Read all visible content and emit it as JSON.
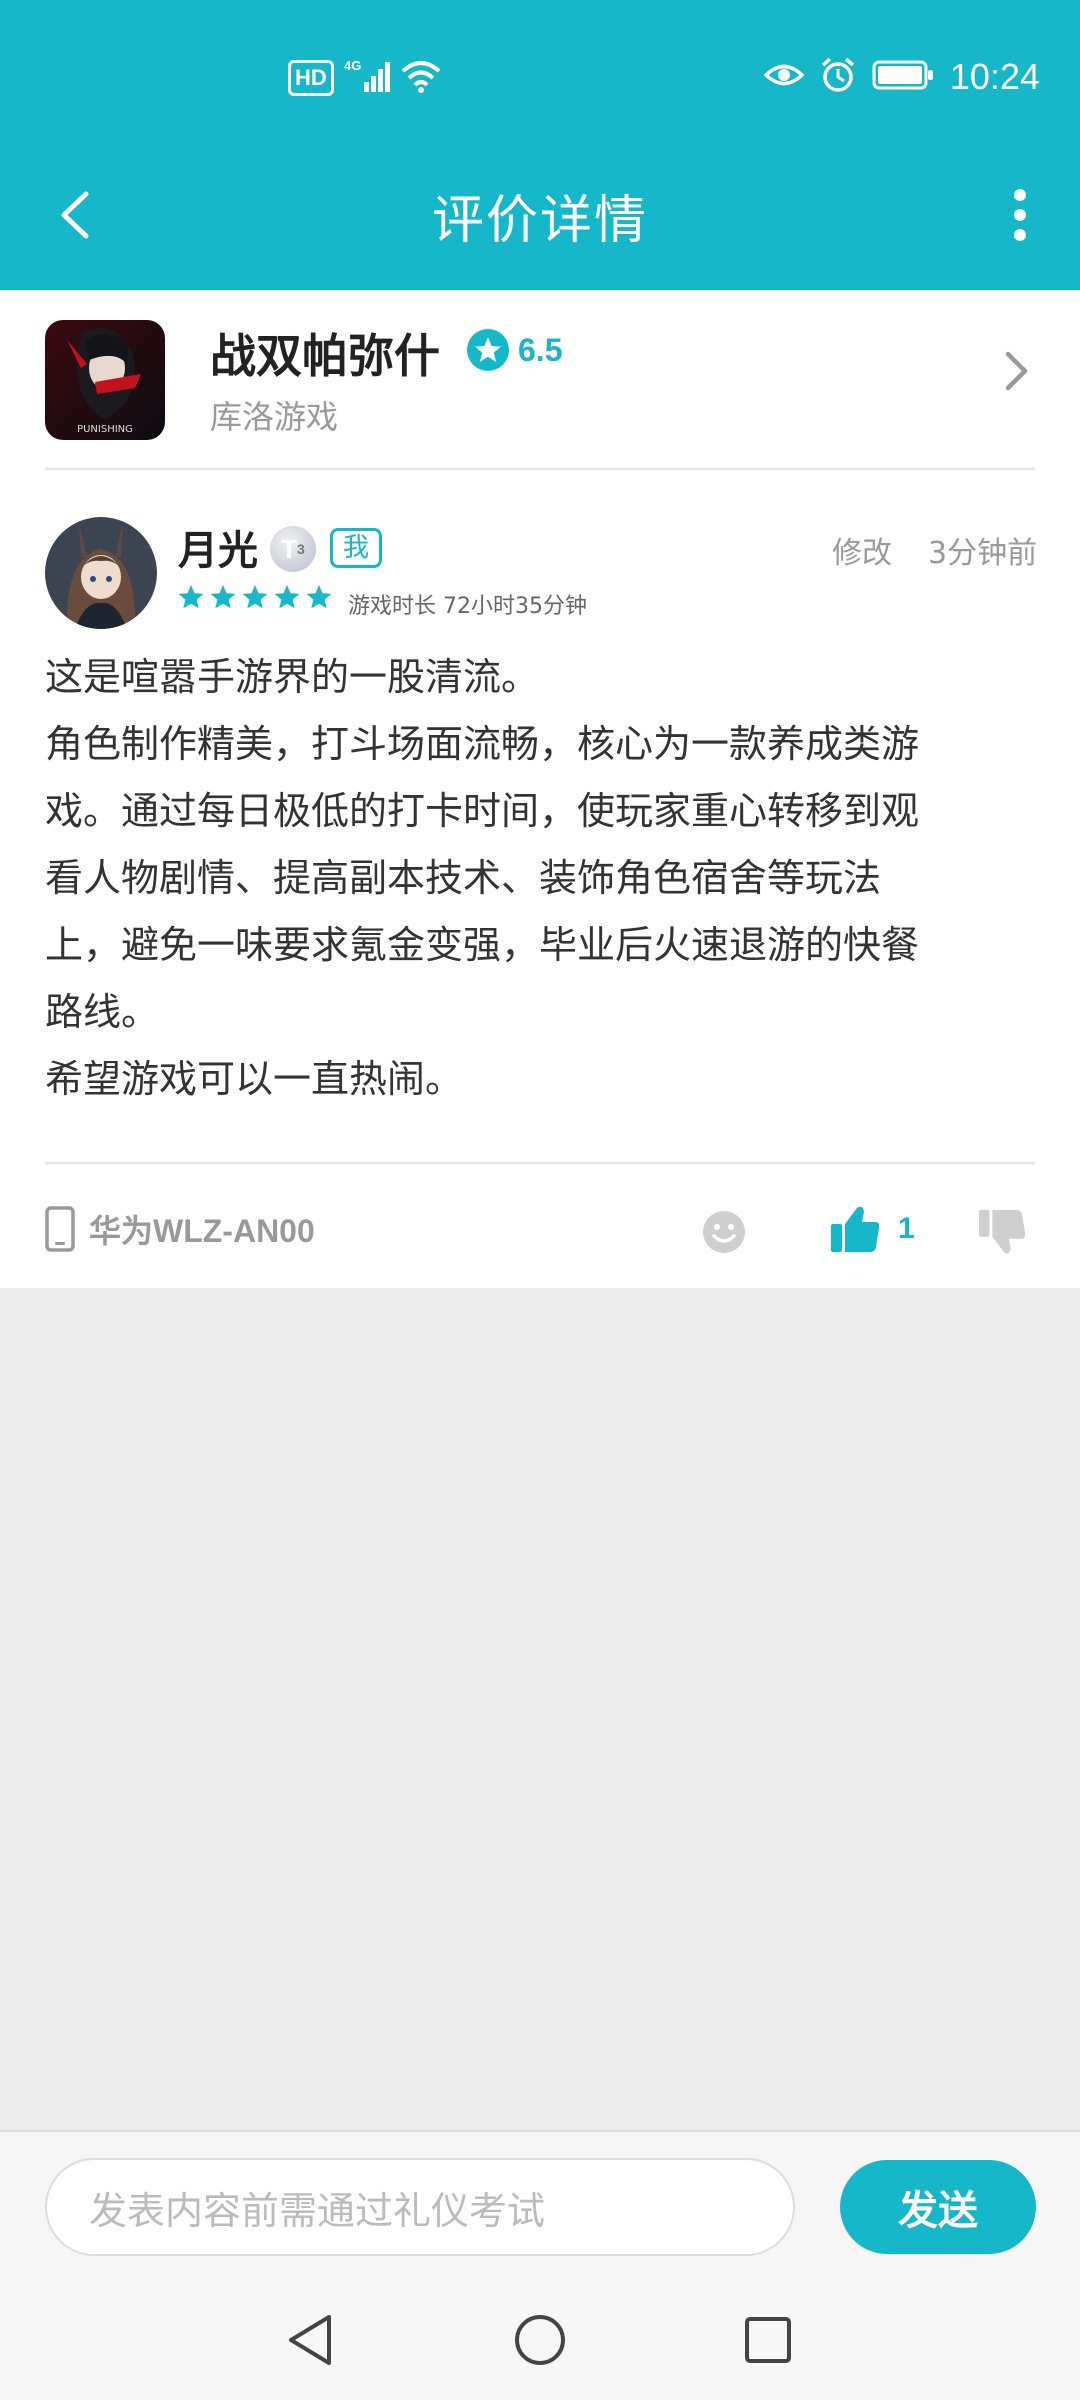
{
  "status_bar": {
    "network": "HD",
    "network_gen": "4G",
    "time": "10:24"
  },
  "header": {
    "title": "评价详情",
    "back_icon": "back-arrow-icon",
    "more_icon": "more-vertical-icon"
  },
  "game": {
    "name": "战双帕弥什",
    "rating": "6.5",
    "publisher": "库洛游戏",
    "icon_text": "PUNISHING"
  },
  "review": {
    "user_name": "月光",
    "level_badge": "T",
    "level_number": "3",
    "me_label": "我",
    "edit_label": "修改",
    "time_ago": "3分钟前",
    "star_rating": 5,
    "playtime": "游戏时长 72小时35分钟",
    "body_lines": [
      "这是喧嚣手游界的一股清流。",
      "角色制作精美，打斗场面流畅，核心为一款养成类游",
      "戏。通过每日极低的打卡时间，使玩家重心转移到观",
      "看人物剧情、提高副本技术、装饰角色宿舍等玩法",
      "上，避免一味要求氪金变强，毕业后火速退游的快餐",
      "路线。",
      "希望游戏可以一直热闹。"
    ],
    "device": "华为WLZ-AN00",
    "like_count": "1"
  },
  "comment_bar": {
    "placeholder": "发表内容前需通过礼仪考试",
    "send_label": "发送"
  },
  "colors": {
    "accent": "#16b7c8",
    "background": "#ededed"
  }
}
